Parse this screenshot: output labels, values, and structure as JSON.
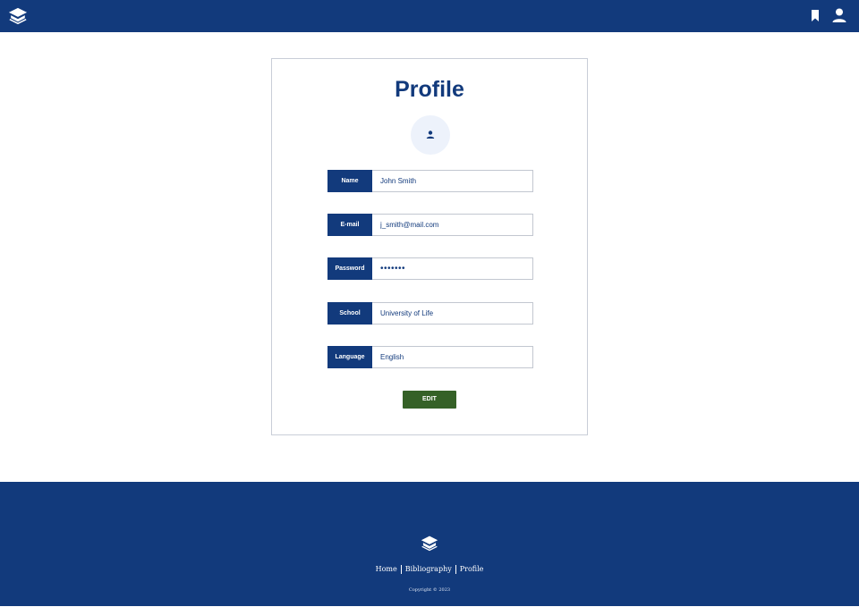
{
  "header": {
    "logo_icon": "graduation-cap-icon",
    "bookmark_icon": "bookmark-icon",
    "user_icon": "user-icon"
  },
  "profile": {
    "title": "Profile",
    "avatar_icon": "user-icon",
    "fields": [
      {
        "label": "Name",
        "value": "John Smith"
      },
      {
        "label": "E-mail",
        "value": "j_smith@mail.com"
      },
      {
        "label": "Password",
        "value": "•••••••"
      },
      {
        "label": "School",
        "value": "University of Life"
      },
      {
        "label": "Language",
        "value": "English"
      }
    ],
    "edit_label": "EDIT"
  },
  "footer": {
    "logo_icon": "graduation-cap-icon",
    "nav": [
      "Home",
      "Bibliography",
      "Profile"
    ],
    "copyright": "Copyright © 2023"
  },
  "colors": {
    "primary": "#123a7c",
    "edit_button": "#356127",
    "avatar_bg": "#edf2fb"
  }
}
